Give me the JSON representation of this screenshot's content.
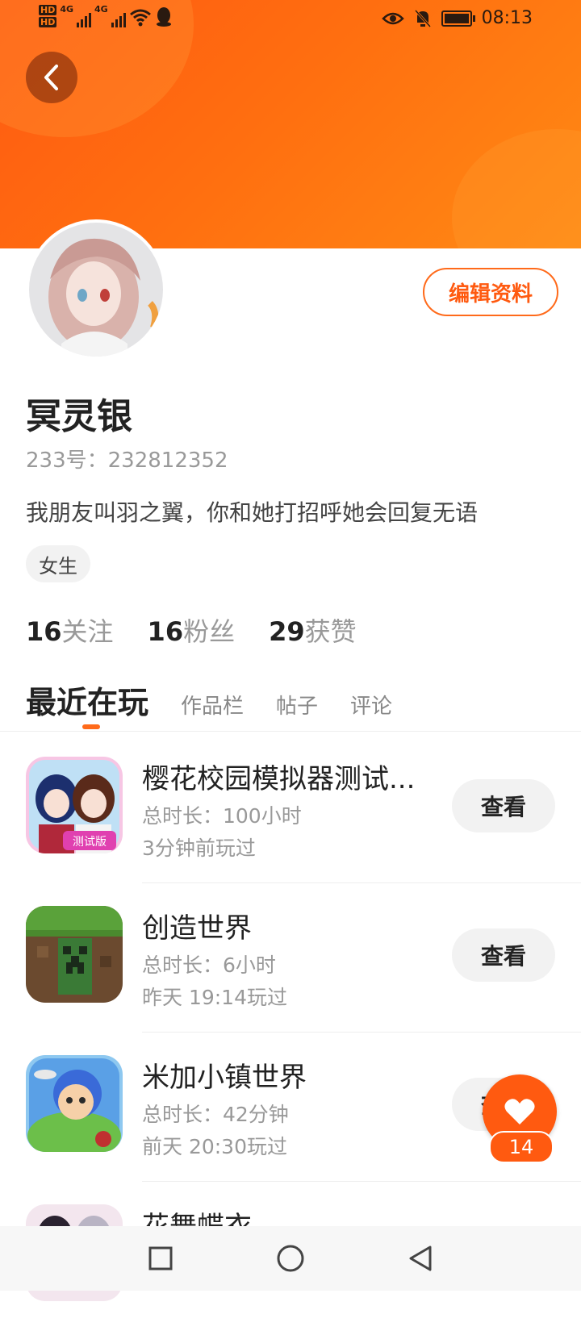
{
  "status_bar": {
    "time": "08:13",
    "network_1": "4G",
    "network_2": "4G",
    "hd_1": "HD",
    "hd_2": "HD"
  },
  "profile": {
    "name": "冥灵银",
    "uid_label": "233号：",
    "uid": "232812352",
    "bio": "我朋友叫羽之翼，你和她打招呼她会回复无语",
    "gender": "女生",
    "edit_label": "编辑资料"
  },
  "stats": [
    {
      "count": "16",
      "label": "关注"
    },
    {
      "count": "16",
      "label": "粉丝"
    },
    {
      "count": "29",
      "label": "获赞"
    }
  ],
  "tabs": [
    "最近在玩",
    "作品栏",
    "帖子",
    "评论"
  ],
  "games": [
    {
      "title": "樱花校园模拟器测试...",
      "duration": "总时长：100小时",
      "played": "3分钟前玩过",
      "view_label": "查看"
    },
    {
      "title": "创造世界",
      "duration": "总时长：6小时",
      "played": "昨天 19:14玩过",
      "view_label": "查看"
    },
    {
      "title": "米加小镇世界",
      "duration": "总时长：42分钟",
      "played": "前天 20:30玩过",
      "view_label": "查看"
    },
    {
      "title": "花舞蝶衣",
      "duration": "",
      "played": "",
      "view_label": ""
    }
  ],
  "icon_badge_text": "测试版",
  "fab": {
    "count": "14",
    "icon": "heart-icon"
  },
  "colors": {
    "accent": "#ff5a10",
    "header_start": "#ff5a12",
    "header_end": "#ff8a14"
  }
}
